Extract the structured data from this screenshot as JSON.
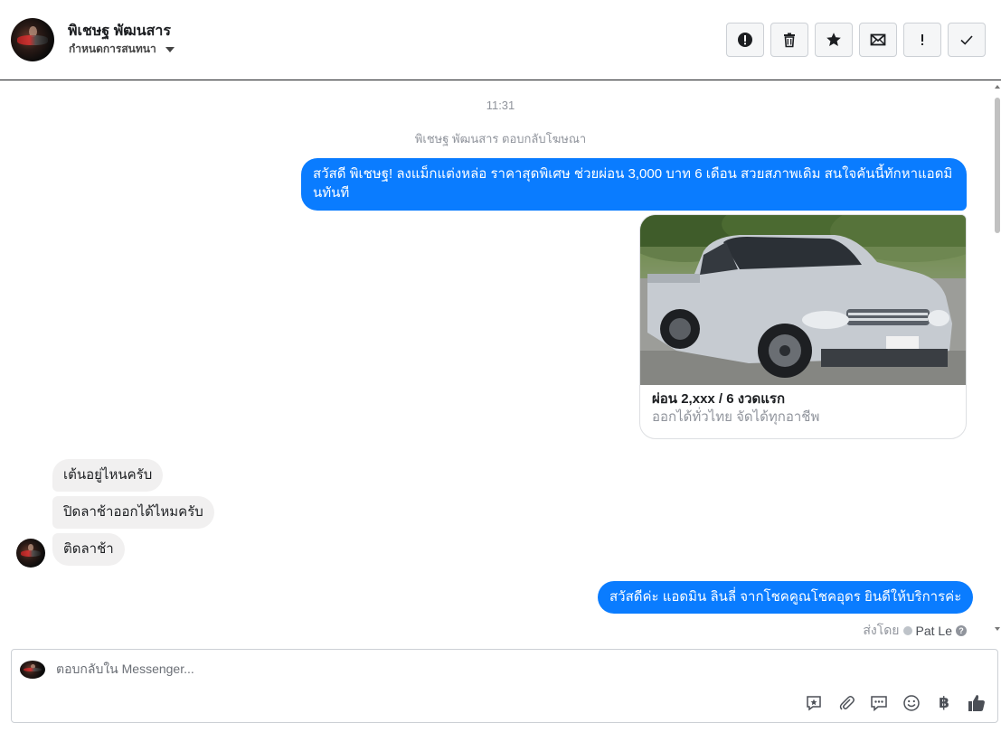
{
  "header": {
    "name": "พิเชษฐ พัฒนสาร",
    "subtitle": "กำหนดการสนทนา"
  },
  "toolbar": [
    {
      "icon": "alert-icon",
      "label": "!"
    },
    {
      "icon": "trash-icon"
    },
    {
      "icon": "star-icon"
    },
    {
      "icon": "mail-icon"
    },
    {
      "icon": "exclamation-icon",
      "label": "!"
    },
    {
      "icon": "check-icon"
    }
  ],
  "chat": {
    "time": "11:31",
    "system_note": "พิเชษฐ พัฒนสาร ตอบกลับโฆษณา",
    "ad_message": "สวัสดี พิเชษฐ! ลงแม็กแต่งหล่อ ราคาสุดพิเศษ ช่วยผ่อน 3,000 บาท 6 เดือน สวยสภาพเดิม สนใจคันนี้ทักหาแอดมินทันที",
    "card": {
      "title": "ผ่อน 2,xxx / 6 งวดแรก",
      "subtitle": "ออกได้ทั่วไทย จัดได้ทุกอาชีพ"
    },
    "incoming": [
      "เต้นอยู่ไหนครับ",
      "ปิดลาช้าออกได้ไหมครับ",
      "ติดลาช้า"
    ],
    "reply": "สวัสดีค่ะ แอดมิน ลินลี่ จากโชคคูณโชคอุดร ยินดีให้บริการค่ะ",
    "sent_by_label": "ส่งโดย",
    "sent_by_name": "Pat Le",
    "help_mark": "?"
  },
  "composer": {
    "placeholder": "ตอบกลับใน Messenger...",
    "tools": [
      "saved-reply-icon",
      "attach-icon",
      "chat-icon",
      "emoji-icon",
      "baht-icon",
      "like-icon"
    ],
    "currency": "฿"
  }
}
